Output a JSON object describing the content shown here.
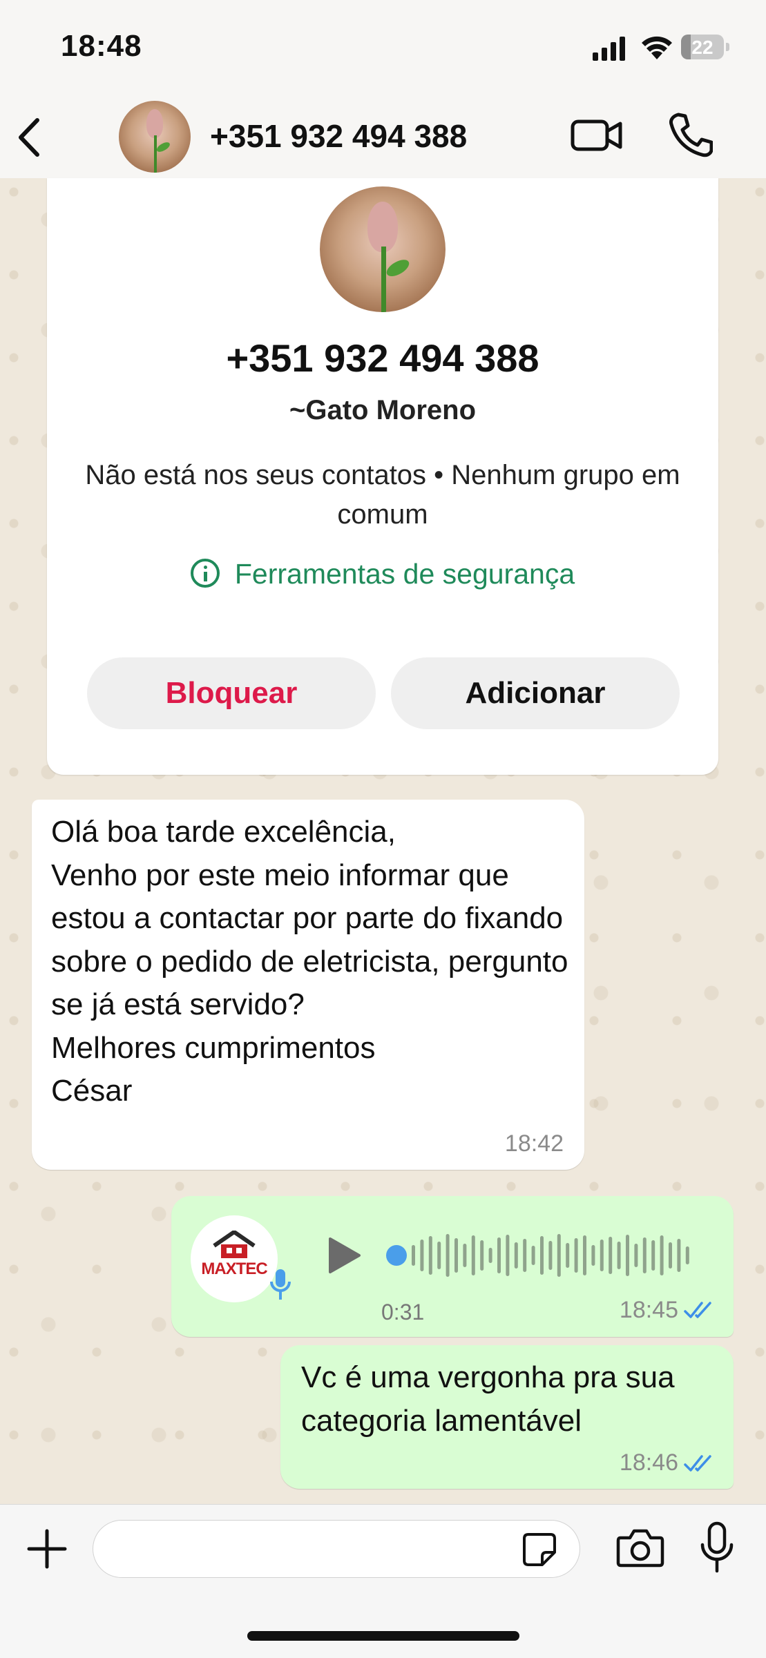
{
  "status_bar": {
    "time": "18:48",
    "battery_level": "22"
  },
  "header": {
    "back_icon": "chevron-left-icon",
    "contact_title": "+351 932 494 388",
    "video_icon": "video-camera-icon",
    "call_icon": "phone-icon"
  },
  "contact_card": {
    "number": "+351 932 494 388",
    "name": "~Gato Moreno",
    "info": "Não está nos seus contatos • Nenhum grupo em comum",
    "safety_tools": "Ferramentas de segurança",
    "block_label": "Bloquear",
    "add_label": "Adicionar",
    "block_color": "#dd1a4a",
    "safety_color": "#1f8a5a"
  },
  "messages": [
    {
      "direction": "incoming",
      "text": "Olá boa tarde excelência,\nVenho por este meio informar que estou a contactar por parte do fixando sobre o pedido de eletricista, pergunto se já está servido?\nMelhores cumprimentos\nCésar",
      "time": "18:42"
    },
    {
      "direction": "outgoing",
      "type": "voice",
      "avatar_text": "MAXTEC",
      "duration": "0:31",
      "time": "18:45",
      "status": "read"
    },
    {
      "direction": "outgoing",
      "text": "Vc é uma vergonha pra sua categoria lamentável",
      "time": "18:46",
      "status": "read"
    }
  ],
  "composer": {
    "placeholder": "",
    "value": ""
  },
  "colors": {
    "outgoing_bubble": "#d9fdd3",
    "incoming_bubble": "#ffffff",
    "read_ticks": "#3d8ee8"
  }
}
